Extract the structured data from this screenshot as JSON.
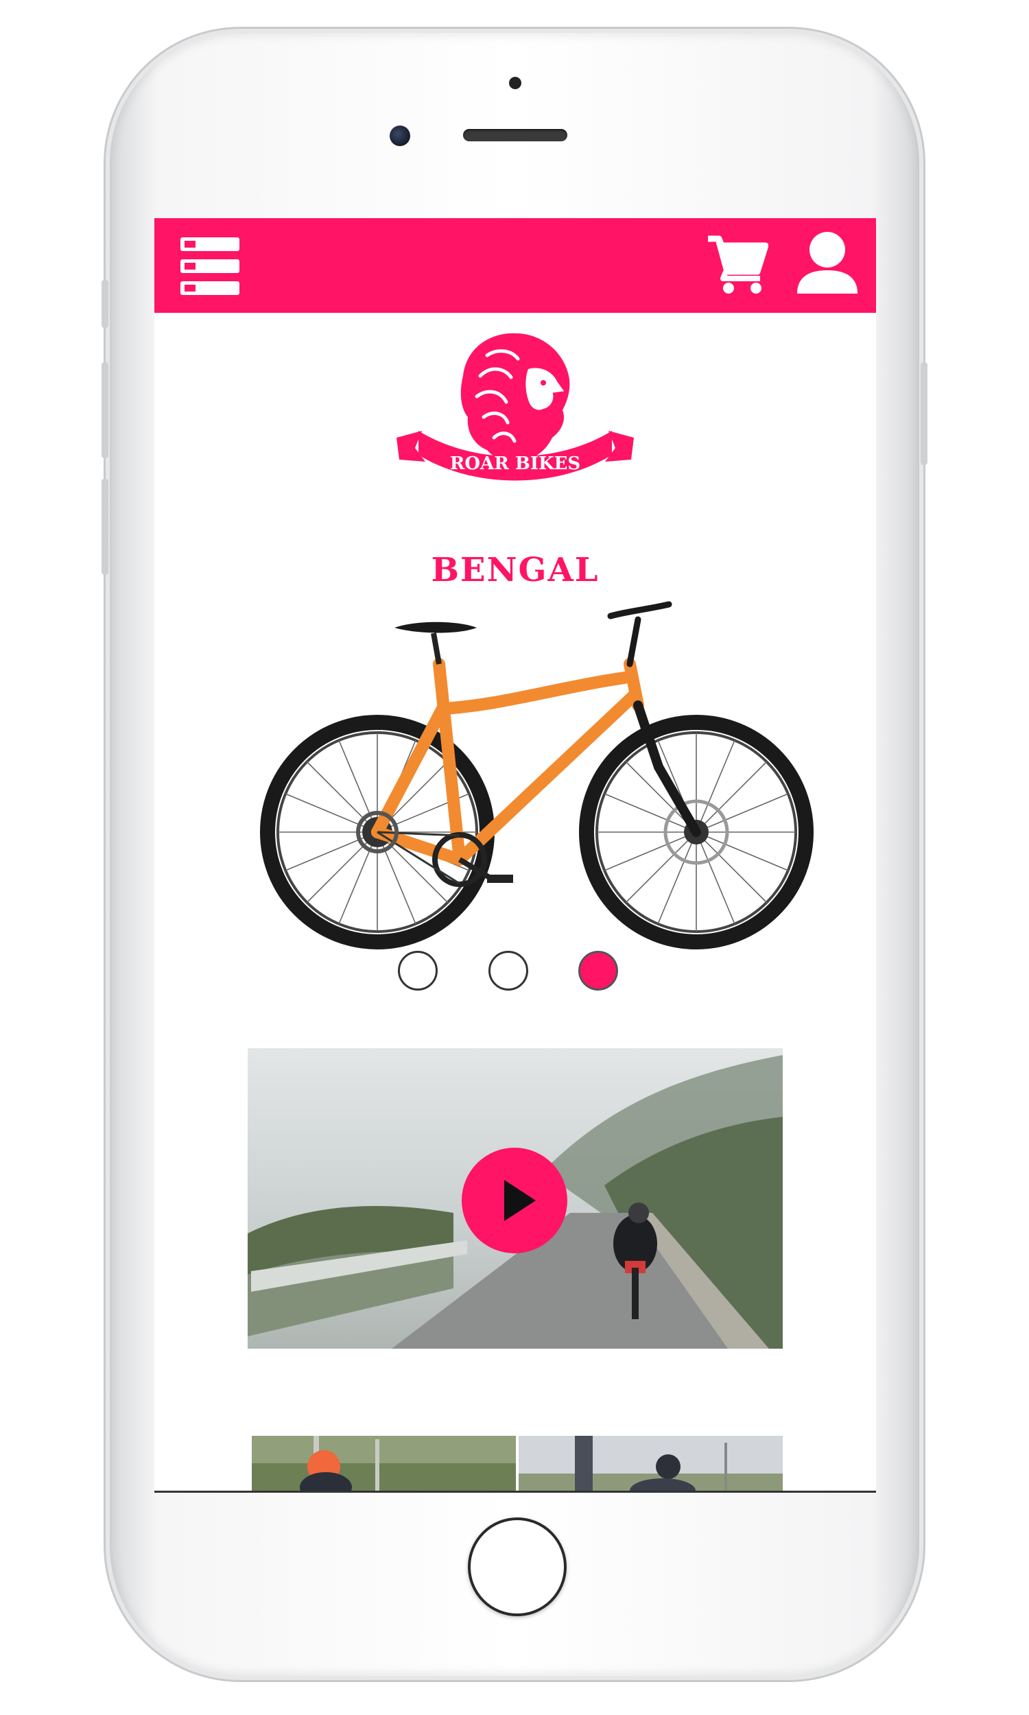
{
  "app": {
    "brand_name": "ROAR BIKES",
    "accent_color": "#ff1466"
  },
  "header": {
    "menu_icon": "menu-list-icon",
    "cart_icon": "shopping-cart-icon",
    "account_icon": "user-icon"
  },
  "product": {
    "title": "BENGAL"
  },
  "carousel": {
    "slide_count": 3,
    "active_index": 2
  },
  "video": {
    "play_icon": "play-icon"
  }
}
